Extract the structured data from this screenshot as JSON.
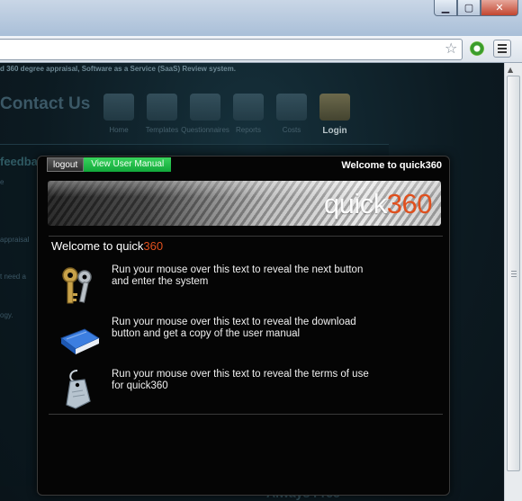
{
  "browser": {
    "window_controls": {
      "minimize": "▁",
      "maximize": "▢",
      "close": "✕"
    }
  },
  "background_page": {
    "tagline": "d 360 degree appraisal, Software as a Service (SaaS) Review system.",
    "contact": "Contact Us",
    "nav": [
      {
        "label": "Home",
        "icon": "home-icon"
      },
      {
        "label": "Templates",
        "icon": "templates-icon"
      },
      {
        "label": "Questionnaires",
        "icon": "questionnaires-icon"
      },
      {
        "label": "Reports",
        "icon": "reports-icon"
      },
      {
        "label": "Costs",
        "icon": "costs-icon"
      },
      {
        "label": "Login",
        "icon": "login-icon"
      }
    ],
    "feedback_heading": "feedba",
    "snippets": [
      "e",
      "appraisal",
      "t need a",
      "ogy."
    ],
    "footer_text": "Always Free"
  },
  "modal": {
    "logout_label": "logout",
    "manual_label": "View User Manual",
    "title": "Welcome to quick360",
    "logo": {
      "prefix": "quick",
      "suffix": "360"
    },
    "heading": {
      "prefix": "Welcome to quick",
      "suffix": "360"
    },
    "actions": [
      {
        "icon": "keys-icon",
        "text": "Run your mouse over this text to reveal the next button and enter the system"
      },
      {
        "icon": "manual-book-icon",
        "text": "Run your mouse over this text to reveal the download button and get a copy of the user manual"
      },
      {
        "icon": "terms-tag-icon",
        "text": "Run your mouse over this text to reveal the terms of use for quick360"
      }
    ]
  },
  "colors": {
    "brand_orange": "#e0501e",
    "manual_green": "#1fb646",
    "modal_bg": "#050505"
  }
}
